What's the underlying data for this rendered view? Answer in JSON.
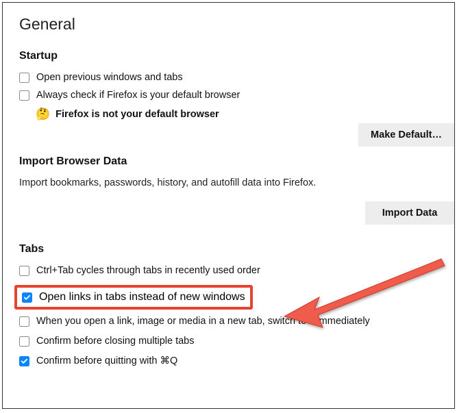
{
  "page": {
    "title": "General"
  },
  "startup": {
    "heading": "Startup",
    "open_previous": "Open previous windows and tabs",
    "check_default": "Always check if Firefox is your default browser",
    "warn_emoji": "🤔",
    "warn_text": "Firefox is not your default browser",
    "make_default_btn": "Make Default…"
  },
  "import": {
    "heading": "Import Browser Data",
    "desc": "Import bookmarks, passwords, history, and autofill data into Firefox.",
    "btn": "Import Data"
  },
  "tabs": {
    "heading": "Tabs",
    "ctrl_tab": "Ctrl+Tab cycles through tabs in recently used order",
    "open_links": "Open links in tabs instead of new windows",
    "switch_immediate": "When you open a link, image or media in a new tab, switch to it immediately",
    "confirm_close": "Confirm before closing multiple tabs",
    "confirm_quit": "Confirm before quitting with ⌘Q"
  }
}
